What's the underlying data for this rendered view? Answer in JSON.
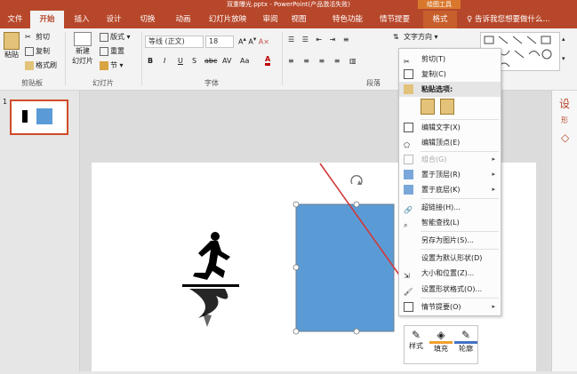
{
  "window": {
    "title": "双重曝光.pptx - PowerPoint(产品激活失败)",
    "context_tools": "绘图工具"
  },
  "tabs": [
    "文件",
    "开始",
    "插入",
    "设计",
    "切换",
    "动画",
    "幻灯片放映",
    "审阅",
    "视图",
    "特色功能",
    "情节提要",
    "格式"
  ],
  "active_tab": "开始",
  "tell_me": "告诉我您想要做什么...",
  "clipboard": {
    "paste": "粘贴",
    "cut": "剪切",
    "copy": "复制",
    "format_painter": "格式刷",
    "group": "剪贴板"
  },
  "slides_group": {
    "new_slide": "新建\n幻灯片",
    "new_slide_line1": "新建",
    "new_slide_line2": "幻灯片",
    "layout": "版式",
    "reset": "重置",
    "section": "节",
    "group": "幻灯片"
  },
  "font_group": {
    "font_name": "等线 (正文)",
    "font_size": "18",
    "group": "字体",
    "bold": "B",
    "italic": "I",
    "underline": "U",
    "shadow": "S",
    "strike": "abc",
    "spacing": "AV",
    "case": "Aa",
    "color": "A"
  },
  "paragraph_group": {
    "group": "段落",
    "text_direction": "文字方向"
  },
  "thumbnail": {
    "number": "1"
  },
  "context_menu": {
    "cut": "剪切(T)",
    "copy": "复制(C)",
    "paste_options": "粘贴选项:",
    "edit_text": "编辑文字(X)",
    "edit_points": "编辑顶点(E)",
    "group": "组合(G)",
    "bring_front": "置于顶层(R)",
    "send_back": "置于底层(K)",
    "hyperlink": "超链接(H)...",
    "smart_lookup": "智能查找(L)",
    "save_as_picture": "另存为图片(S)...",
    "set_default": "设置为默认形状(D)",
    "size_position": "大小和位置(Z)...",
    "format_shape": "设置形状格式(O)...",
    "storyboard": "情节提要(O)"
  },
  "mini_toolbar": {
    "style": "样式",
    "fill": "填充",
    "outline": "轮廓"
  },
  "right_pane": {
    "title": "设",
    "sub": "形"
  },
  "colors": {
    "accent": "#b7472a",
    "shape": "#5b9bd5",
    "arrow": "#d0393a"
  }
}
